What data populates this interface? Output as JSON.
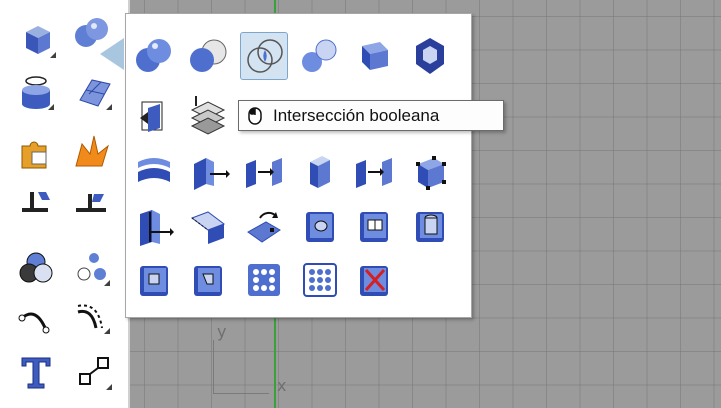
{
  "tooltip": {
    "icon": "mouse-icon",
    "text": "Intersección booleana"
  },
  "viewport": {
    "axis_y_label": "y",
    "axis_x_label": "x",
    "grid_color": "#9b9b9b",
    "y_axis_color": "#3aa03a"
  },
  "left_toolbar": {
    "buttons": [
      "box-icon",
      "spheres-union-icon",
      "cylinder-icon",
      "surface-icon",
      "puzzle-icon",
      "explode-icon",
      "split-icon",
      "trim-icon",
      "render-icon",
      "points-icon",
      "curve-icon",
      "curve-offset-icon",
      "text-icon",
      "transform-icon"
    ]
  },
  "flyout": {
    "title_tool": "solid-tools",
    "active_tool": "boolean-intersection",
    "rows": [
      [
        "boolean-union-icon",
        "boolean-difference-icon",
        "boolean-intersection-icon",
        "boolean-split-icon",
        "create-solid-icon",
        "cap-planar-holes-icon"
      ],
      [
        "extract-surface-icon",
        "merge-faces-icon",
        "",
        "",
        "",
        ""
      ],
      [
        "fillet-edges-icon",
        "move-face-icon",
        "move-faces-to-boundary-icon",
        "extrude-face-icon",
        "move-edge-icon",
        "solid-points-icon"
      ],
      [
        "split-faces-icon",
        "fold-face-icon",
        "rotate-face-icon",
        "make-hole-icon",
        "place-hole-icon",
        "round-hole-icon"
      ],
      [
        "move-hole-icon",
        "rotate-hole-icon",
        "array-hole-icon",
        "array-hole-polar-icon",
        "delete-hole-icon"
      ]
    ]
  }
}
